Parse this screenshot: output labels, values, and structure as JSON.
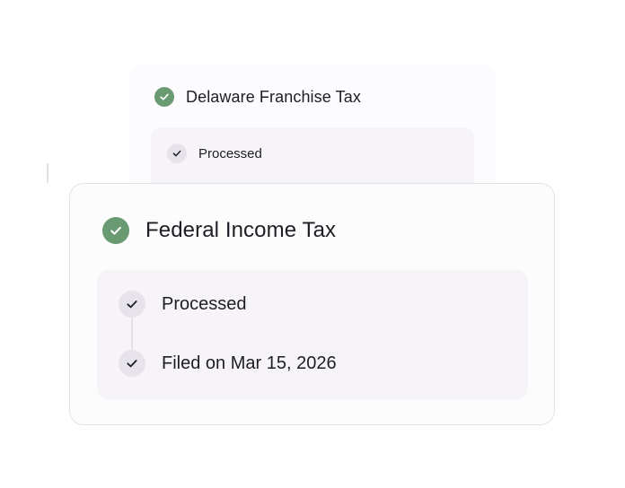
{
  "colors": {
    "success_badge": "#6a9a72",
    "step_dot": "#e6e4ea",
    "panel_bg": "#f6f4f8",
    "text": "#1f1d24"
  },
  "background_card": {
    "title": "Delaware Franchise Tax",
    "status_icon": "check-circle-icon",
    "steps": [
      {
        "label": "Processed",
        "icon": "check-icon"
      }
    ]
  },
  "foreground_card": {
    "title": "Federal Income Tax",
    "status_icon": "check-circle-icon",
    "steps": [
      {
        "label": "Processed",
        "icon": "check-icon"
      },
      {
        "label": "Filed on Mar 15, 2026",
        "icon": "check-icon"
      }
    ]
  }
}
